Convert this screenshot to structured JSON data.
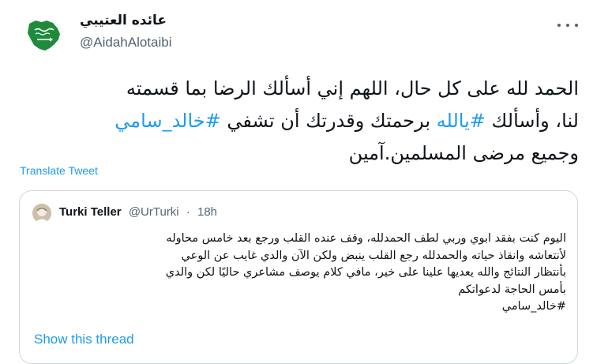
{
  "author": {
    "display_name": "عائده العتيبي",
    "handle": "@AidahAlotaibi",
    "avatar_icon": "saudi-flag-map-avatar"
  },
  "tweet": {
    "lines": [
      "الحمد لله على كل حال، اللهم إني أسألك الرضا بما قسمته",
      "لنا، وأسألك #يالله برحمتك وقدرتك أن تشفي #خالد_سامي",
      "وجميع مرضى المسلمين.آمين"
    ],
    "line2_parts": {
      "a": "لنا، وأسألك ",
      "tag1": "#يالله",
      "b": " برحمتك وقدرتك أن تشفي ",
      "tag2": "#خالد_سامي"
    },
    "translate_label": "Translate Tweet"
  },
  "quote": {
    "name": "Turki Teller",
    "handle": "@UrTurki",
    "time": "18h",
    "separator": "·",
    "lines": [
      "اليوم كنت بفقد ابوي وربي لطف الحمدلله، وقف عنده القلب ورجع بعد خامس محاوله",
      "لأنتعاشه وانقاذ حياته والحمدلله رجع القلب ينبض ولكن الآن والدي غايب عن الوعي",
      "بأنتظار النتائج والله يعديها علينا على خير، مافي كلام يوصف مشاعري حاليًا لكن والدي",
      "بأمس الحاجة لدعواتكم",
      "#خالد_سامي"
    ],
    "show_thread_label": "Show this thread"
  },
  "colors": {
    "link": "#1d9bf0",
    "text": "#0f1419",
    "muted": "#536471",
    "border": "#cfd9de",
    "flag_green": "#1f8a3c"
  }
}
